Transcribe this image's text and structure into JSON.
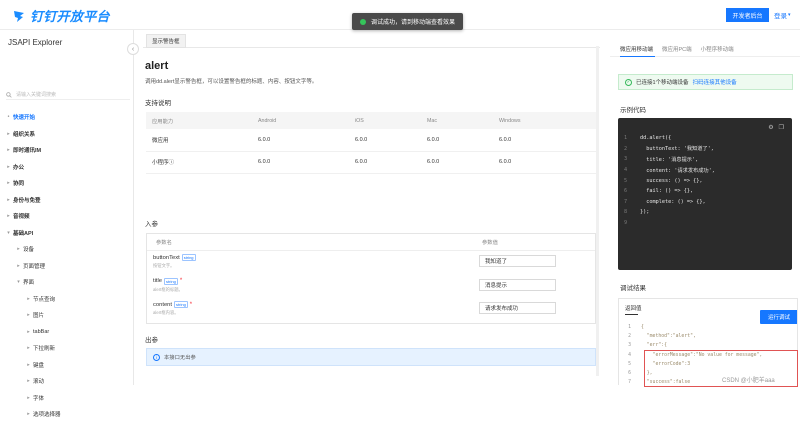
{
  "header": {
    "logo_text": "钉钉开放平台",
    "toast_text": "调试成功，请到移动端查看效果",
    "console_button": "开发者后台",
    "login_label": "登录"
  },
  "sidebar": {
    "title": "JSAPI Explorer",
    "search_placeholder": "请输入关键词搜索",
    "items": [
      {
        "label": "快速开始",
        "caret": "•",
        "level": 0,
        "active": true
      },
      {
        "label": "组织关系",
        "caret": "▸",
        "level": 0
      },
      {
        "label": "即时通讯IM",
        "caret": "▸",
        "level": 0
      },
      {
        "label": "办公",
        "caret": "▸",
        "level": 0
      },
      {
        "label": "协同",
        "caret": "▸",
        "level": 0
      },
      {
        "label": "身份与免登",
        "caret": "▸",
        "level": 0
      },
      {
        "label": "音视频",
        "caret": "▸",
        "level": 0
      },
      {
        "label": "基础API",
        "caret": "▾",
        "level": 0
      },
      {
        "label": "设备",
        "caret": "▸",
        "level": 1
      },
      {
        "label": "页面管理",
        "caret": "▸",
        "level": 1
      },
      {
        "label": "界面",
        "caret": "▾",
        "level": 1
      },
      {
        "label": "节点查询",
        "caret": "▸",
        "level": 2
      },
      {
        "label": "图片",
        "caret": "▸",
        "level": 2
      },
      {
        "label": "tabBar",
        "caret": "▸",
        "level": 2
      },
      {
        "label": "下拉刷新",
        "caret": "▸",
        "level": 2
      },
      {
        "label": "键盘",
        "caret": "▸",
        "level": 2
      },
      {
        "label": "滚动",
        "caret": "▸",
        "level": 2
      },
      {
        "label": "字体",
        "caret": "▸",
        "level": 2
      },
      {
        "label": "选项选择器",
        "caret": "▸",
        "level": 2
      }
    ]
  },
  "main": {
    "tab_label": "显示警告框",
    "api_name": "alert",
    "api_desc": "调用dd.alert显示警告框，可以设置警告框的标题、内容、按钮文字等。",
    "support_title": "支持说明",
    "support_headers": [
      "应用能力",
      "Android",
      "iOS",
      "Mac",
      "Windows"
    ],
    "support_rows": [
      [
        "微应用",
        "6.0.0",
        "6.0.0",
        "6.0.0",
        "6.0.0"
      ],
      [
        "小程序ⓘ",
        "6.0.0",
        "6.0.0",
        "6.0.0",
        "6.0.0"
      ]
    ],
    "params_title": "入参",
    "param_headers": [
      "参数名",
      "参数值"
    ],
    "params": [
      {
        "name": "buttonText",
        "type": "string",
        "required": "",
        "desc": "按钮文字。",
        "value": "我知道了"
      },
      {
        "name": "title",
        "type": "string",
        "required": "*",
        "desc": "alert框的标题。",
        "value": "消息提示"
      },
      {
        "name": "content",
        "type": "string",
        "required": "*",
        "desc": "alert框内容。",
        "value": "请求发布成功"
      }
    ],
    "output_title": "出参",
    "output_info": "本接口无出参"
  },
  "right": {
    "tabs": [
      "微应用移动端",
      "微应用PC端",
      "小程序移动端"
    ],
    "connection_text": "已连接1个移动端设备",
    "connection_link": "扫码连接其他设备",
    "example_title": "示例代码",
    "code_lines": [
      {
        "n": "1",
        "t": "dd.alert({"
      },
      {
        "n": "2",
        "t": "  buttonText: '我知道了',"
      },
      {
        "n": "3",
        "t": "  title: '消息提示',"
      },
      {
        "n": "4",
        "t": "  content: '请求发布成功',"
      },
      {
        "n": "5",
        "t": "  success: () => {},"
      },
      {
        "n": "6",
        "t": "  fail: () => {},"
      },
      {
        "n": "7",
        "t": "  complete: () => {},"
      },
      {
        "n": "8",
        "t": "});"
      },
      {
        "n": "9",
        "t": ""
      }
    ],
    "run_button": "运行调试",
    "result_title": "调试结果",
    "result_tab": "返回值",
    "result_lines": [
      {
        "n": "1",
        "t": "{"
      },
      {
        "n": "2",
        "t": "  \"method\":\"alert\","
      },
      {
        "n": "3",
        "t": "  \"err\":{"
      },
      {
        "n": "4",
        "t": "    \"errorMessage\":\"No value for message\","
      },
      {
        "n": "5",
        "t": "    \"errorCode\":3"
      },
      {
        "n": "6",
        "t": "  },"
      },
      {
        "n": "7",
        "t": "  \"success\":false"
      }
    ]
  },
  "watermark": "CSDN @小肥羊aaa"
}
